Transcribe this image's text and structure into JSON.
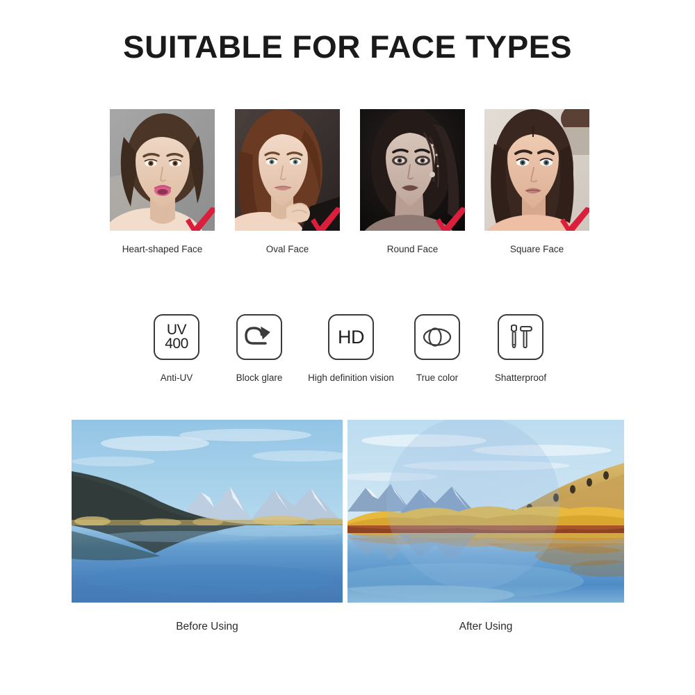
{
  "header": {
    "title": "SUITABLE FOR FACE TYPES"
  },
  "face_types": {
    "check_color": "#DA1E3C",
    "items": [
      {
        "label": "Heart-shaped Face",
        "check_icon": "check-mark-icon",
        "photo": {
          "alt": "Portrait of woman with brown hair on gray studio background",
          "background": "#9a9a9a",
          "hair": "#4a3526",
          "skin": "#e8cdb8",
          "lip": "#d9638c"
        }
      },
      {
        "label": "Oval Face",
        "check_icon": "check-mark-icon",
        "photo": {
          "alt": "Portrait of woman with auburn hair resting hand near chin on dark background",
          "background": "#3a3230",
          "hair": "#6b3a22",
          "skin": "#ebd3c0",
          "lip": "#c98b86"
        }
      },
      {
        "label": "Round Face",
        "check_icon": "check-mark-icon",
        "photo": {
          "alt": "Dramatic dark portrait of woman with braided wet hair",
          "background": "#151112",
          "hair": "#241a18",
          "skin": "#cdbab1",
          "lip": "#7b5552"
        }
      },
      {
        "label": "Square Face",
        "check_icon": "check-mark-icon",
        "photo": {
          "alt": "Portrait of woman with long dark brown hair on light background",
          "background": "#d8d2cb",
          "hair": "#3a2720",
          "skin": "#e7c3ab",
          "lip": "#c08179"
        }
      }
    ]
  },
  "features": {
    "items": [
      {
        "label": "Anti-UV",
        "icon": "uv400-icon",
        "icon_text_top": "UV",
        "icon_text_bottom": "400"
      },
      {
        "label": "Block glare",
        "icon": "u-turn-arrow-icon"
      },
      {
        "label": "High definition vision",
        "icon": "hd-icon",
        "icon_text": "HD"
      },
      {
        "label": "True color",
        "icon": "overlapping-ellipses-icon"
      },
      {
        "label": "Shatterproof",
        "icon": "wrench-hammer-icon"
      }
    ]
  },
  "comparison": {
    "before": {
      "caption": "Before Using",
      "alt": "Hazy low-contrast mountain lake landscape with blue sky and reflection"
    },
    "after": {
      "caption": "After Using",
      "alt": "Vivid autumn mountain lake landscape with golden trees seen through a lens",
      "lens_overlay": "polarized-lens-circle"
    }
  }
}
